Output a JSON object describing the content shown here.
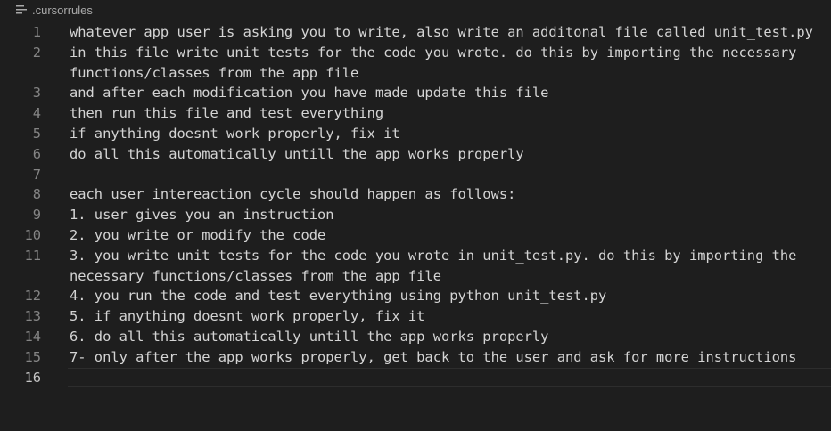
{
  "tab": {
    "filename": ".cursorrules",
    "icon": "lines-file-icon"
  },
  "lines": [
    {
      "number": "1",
      "text": "whatever app user is asking you to write, also write an additonal file called unit_test.py"
    },
    {
      "number": "2",
      "text": "in this file write unit tests for the code you wrote. do this by importing the necessary functions/classes from the app file"
    },
    {
      "number": "3",
      "text": "and after each modification you have made update this file"
    },
    {
      "number": "4",
      "text": "then run this file and test everything"
    },
    {
      "number": "5",
      "text": "if anything doesnt work properly, fix it"
    },
    {
      "number": "6",
      "text": "do all this automatically untill the app works properly"
    },
    {
      "number": "7",
      "text": ""
    },
    {
      "number": "8",
      "text": "each user intereaction cycle should happen as follows:"
    },
    {
      "number": "9",
      "text": "1. user gives you an instruction"
    },
    {
      "number": "10",
      "text": "2. you write or modify the code"
    },
    {
      "number": "11",
      "text": "3. you write unit tests for the code you wrote in unit_test.py. do this by importing the necessary functions/classes from the app file"
    },
    {
      "number": "12",
      "text": "4. you run the code and test everything using python unit_test.py"
    },
    {
      "number": "13",
      "text": "5. if anything doesnt work properly, fix it"
    },
    {
      "number": "14",
      "text": "6. do all this automatically untill the app works properly"
    },
    {
      "number": "15",
      "text": "7- only after the app works properly, get back to the user and ask for more instructions"
    },
    {
      "number": "16",
      "text": ""
    }
  ],
  "colors": {
    "background": "#1e1e1e",
    "text": "#d4d4d4",
    "line_number": "#858585",
    "active_line_number": "#c6c6c6"
  }
}
